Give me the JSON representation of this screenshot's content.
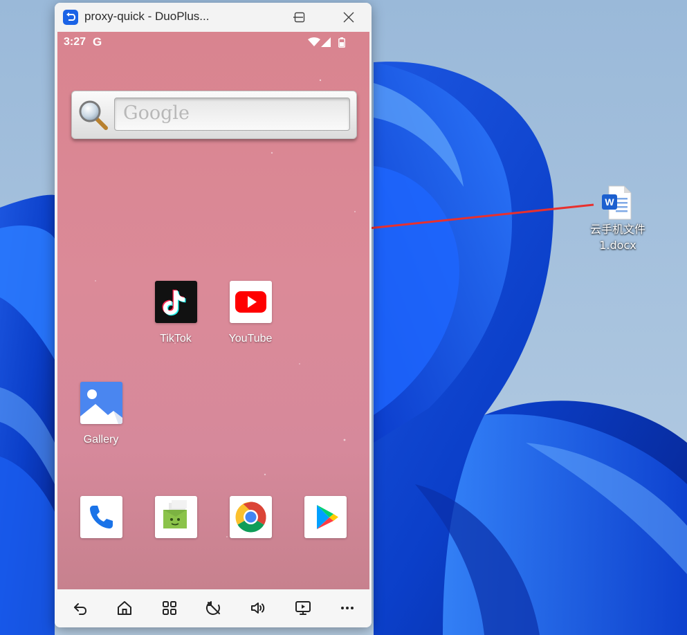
{
  "desktop": {
    "file_icon_letter": "W",
    "file_label_line1": "云手机文件",
    "file_label_line2": "1.docx"
  },
  "window": {
    "title": "proxy-quick - DuoPlus...",
    "accent": "#1b63e6"
  },
  "phone": {
    "status": {
      "time": "3:27",
      "carrier_glyph": "G"
    },
    "search": {
      "placeholder": "Google"
    },
    "apps": {
      "tiktok": "TikTok",
      "youtube": "YouTube",
      "gallery": "Gallery"
    },
    "dock": [
      "phone-icon",
      "messages-icon",
      "chrome-icon",
      "play-store-icon"
    ]
  },
  "navbar": {
    "buttons": [
      "back-icon",
      "home-icon",
      "apps-grid-icon",
      "rotate-off-icon",
      "volume-icon",
      "screen-cast-icon",
      "more-icon"
    ]
  },
  "annotation": {
    "arrow_color": "#e8302e"
  }
}
